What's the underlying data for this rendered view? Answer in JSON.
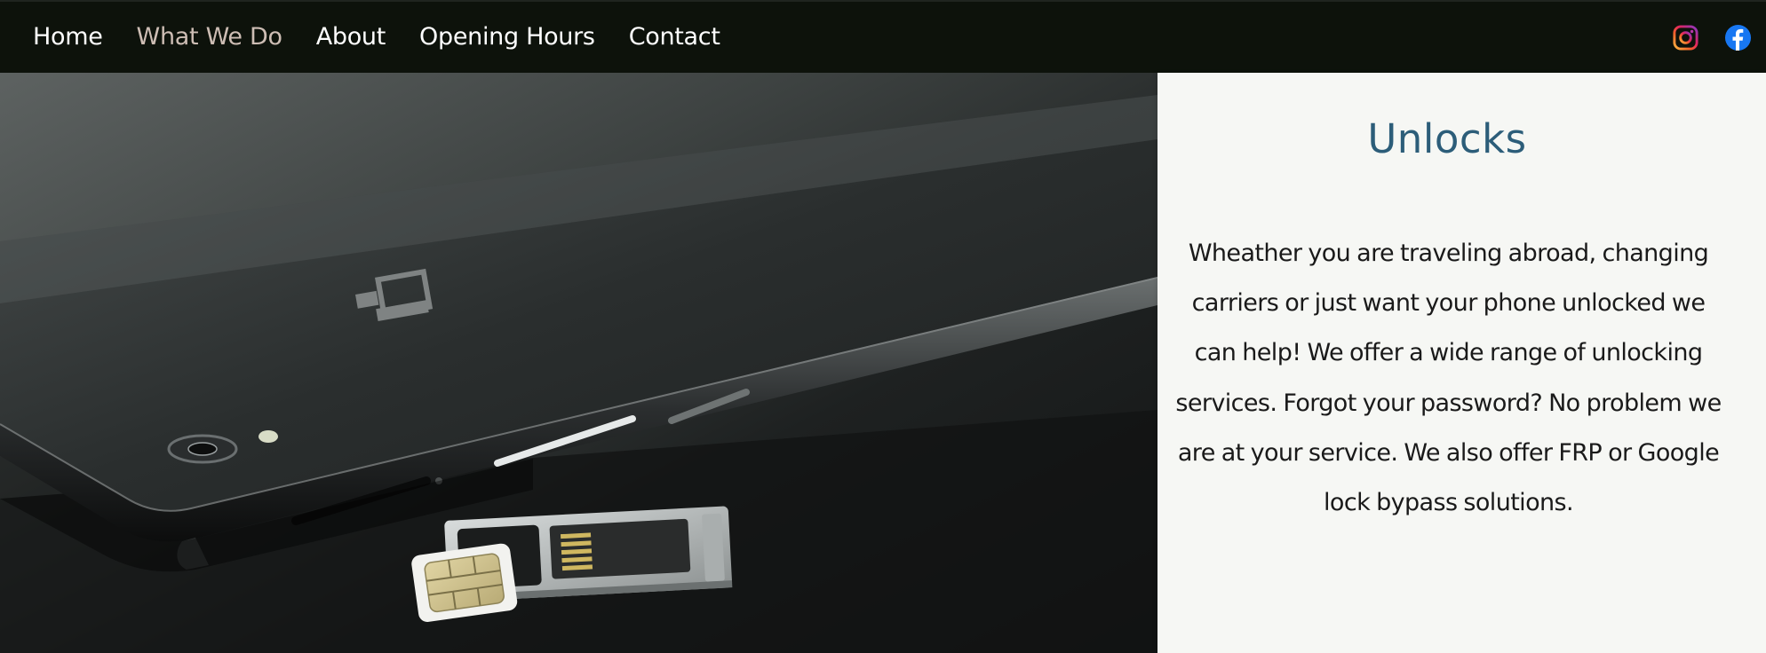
{
  "nav": {
    "items": [
      {
        "label": "Home",
        "active": false
      },
      {
        "label": "What We Do",
        "active": true
      },
      {
        "label": "About",
        "active": false
      },
      {
        "label": "Opening Hours",
        "active": false
      },
      {
        "label": "Contact",
        "active": false
      }
    ],
    "active_color": "#cdbdb4",
    "background": "#0d120b"
  },
  "social": {
    "icons": [
      "instagram-icon",
      "facebook-icon"
    ]
  },
  "hero": {
    "image": "black-smartphone-with-sim-card-tray"
  },
  "panel": {
    "title": "Unlocks",
    "title_color": "#2c5d79",
    "body": "Wheather you are traveling abroad, changing carriers or just want your phone unlocked we can help! We offer a wide range of unlocking services. Forgot your password? No problem we are at your service.  We also offer FRP or Google lock bypass solutions."
  }
}
